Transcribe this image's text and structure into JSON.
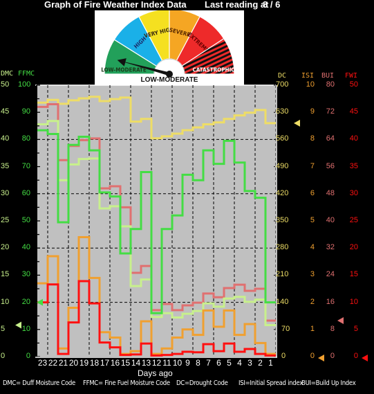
{
  "header": {
    "title": "Graph of Fire Weather Index Data",
    "last_reading_label": "Last reading at",
    "last_reading_date": "8 / 6"
  },
  "gauge": {
    "segments": [
      {
        "label": "LOW-MODERATE",
        "color": "#22a05a"
      },
      {
        "label": "HIGH",
        "color": "#1ab0e8"
      },
      {
        "label": "VERY HIGH",
        "color": "#f5e020"
      },
      {
        "label": "SEVERE",
        "color": "#f5a623"
      },
      {
        "label": "EXTREME",
        "color": "#ee2a2a"
      },
      {
        "label": "CATASTROPHIC",
        "color": "#ee2a2a"
      }
    ],
    "current_rating": "LOW-MODERATE"
  },
  "axes": {
    "left": [
      {
        "name": "DMC",
        "color": "#c8f08c",
        "ticks": [
          "50",
          "45",
          "40",
          "35",
          "30",
          "25",
          "20",
          "15",
          "10",
          "5",
          "0"
        ]
      },
      {
        "name": "FFMC",
        "color": "#44dd44",
        "ticks": [
          "100",
          "90",
          "80",
          "70",
          "60",
          "50",
          "40",
          "30",
          "20",
          "10",
          "0"
        ]
      }
    ],
    "right": [
      {
        "name": "DC",
        "color": "#eedd66",
        "ticks": [
          "700",
          "630",
          "560",
          "490",
          "420",
          "350",
          "280",
          "210",
          "140",
          "70",
          "0"
        ]
      },
      {
        "name": "ISI",
        "color": "#f0a030",
        "ticks": [
          "10",
          "9",
          "8",
          "7",
          "6",
          "5",
          "4",
          "3",
          "2",
          "1",
          "0"
        ]
      },
      {
        "name": "BUI",
        "color": "#e07070",
        "ticks": [
          "80",
          "72",
          "64",
          "56",
          "48",
          "40",
          "32",
          "24",
          "16",
          "8",
          "0"
        ]
      },
      {
        "name": "FWI",
        "color": "#ff1010",
        "ticks": [
          "50",
          "45",
          "40",
          "35",
          "30",
          "25",
          "20",
          "15",
          "10",
          "5",
          "0"
        ]
      }
    ]
  },
  "footer": {
    "xlabel": "Days ago",
    "legend_text": [
      "DMC= Duff Moisture Code",
      "FFMC= Fine Fuel Moisture Code",
      "DC=Drought Code",
      "ISI=Initial Spread index",
      "BUI=Build Up Index"
    ]
  },
  "chart_data": {
    "type": "line",
    "step": true,
    "title": "Graph of Fire Weather Index Data",
    "xlabel": "Days ago",
    "x": [
      23,
      22,
      21,
      20,
      19,
      18,
      17,
      16,
      15,
      14,
      13,
      12,
      11,
      10,
      9,
      8,
      7,
      6,
      5,
      4,
      3,
      2,
      1
    ],
    "grid": true,
    "background": "#c0c0c0",
    "series": [
      {
        "name": "DC",
        "color": "#eedd66",
        "ylim": [
          0,
          700
        ],
        "values": [
          655,
          662,
          652,
          661,
          666,
          670,
          659,
          664,
          668,
          606,
          613,
          563,
          568,
          575,
          584,
          591,
          599,
          604,
          613,
          622,
          629,
          636,
          602
        ]
      },
      {
        "name": "BUI",
        "color": "#e07070",
        "ylim": [
          0,
          80
        ],
        "values": [
          73.6,
          74.4,
          57.9,
          62.1,
          63.8,
          64.3,
          49.6,
          50.2,
          44,
          24.7,
          26.7,
          13.7,
          15.5,
          13.7,
          15.1,
          15.9,
          18.6,
          17.5,
          20.2,
          21.2,
          19.4,
          20,
          10.6
        ]
      },
      {
        "name": "DMC",
        "color": "#c8f08c",
        "ylim": [
          0,
          50
        ],
        "values": [
          42.8,
          43.4,
          32.5,
          35.4,
          36.4,
          36.5,
          27.3,
          27.7,
          24,
          13,
          14.2,
          7.3,
          8,
          7.2,
          7.9,
          8.4,
          9.8,
          9.2,
          10.7,
          11,
          10.1,
          10.5,
          5.8
        ]
      },
      {
        "name": "FFMC",
        "color": "#44dd44",
        "ylim": [
          0,
          100
        ],
        "values": [
          83.4,
          82,
          49.5,
          78,
          81,
          76,
          60.5,
          59,
          38,
          47,
          68,
          16,
          47,
          52,
          67,
          65,
          76,
          71,
          79.5,
          71.5,
          61,
          58.5,
          20
        ]
      },
      {
        "name": "ISI",
        "color": "#f0a030",
        "ylim": [
          0,
          10
        ],
        "values": [
          2.7,
          3.7,
          0.3,
          1.8,
          4.4,
          2.9,
          0.9,
          0.7,
          0.1,
          0.2,
          1.3,
          0.1,
          0.3,
          0.7,
          1,
          0.8,
          1.7,
          1.1,
          1.7,
          0.8,
          1.2,
          0.5,
          0.1
        ]
      },
      {
        "name": "FWI",
        "color": "#ff1010",
        "ylim": [
          0,
          50
        ],
        "values": [
          10,
          13.3,
          0.5,
          6.3,
          13.9,
          9.8,
          2.6,
          1.7,
          0.3,
          0.4,
          2.4,
          0.2,
          0.3,
          0.5,
          0.9,
          0.8,
          2.3,
          1,
          2.4,
          0.9,
          1.4,
          0.5,
          0.2
        ]
      }
    ],
    "current_markers": [
      {
        "series": "DMC",
        "value": 5.8,
        "side": "left"
      },
      {
        "series": "FFMC",
        "value": 20,
        "side": "left"
      },
      {
        "series": "DC",
        "value": 602,
        "side": "right"
      },
      {
        "series": "ISI",
        "value": 0,
        "side": "right"
      },
      {
        "series": "BUI",
        "value": 10.6,
        "side": "right"
      },
      {
        "series": "FWI",
        "value": 0,
        "side": "right"
      }
    ]
  }
}
